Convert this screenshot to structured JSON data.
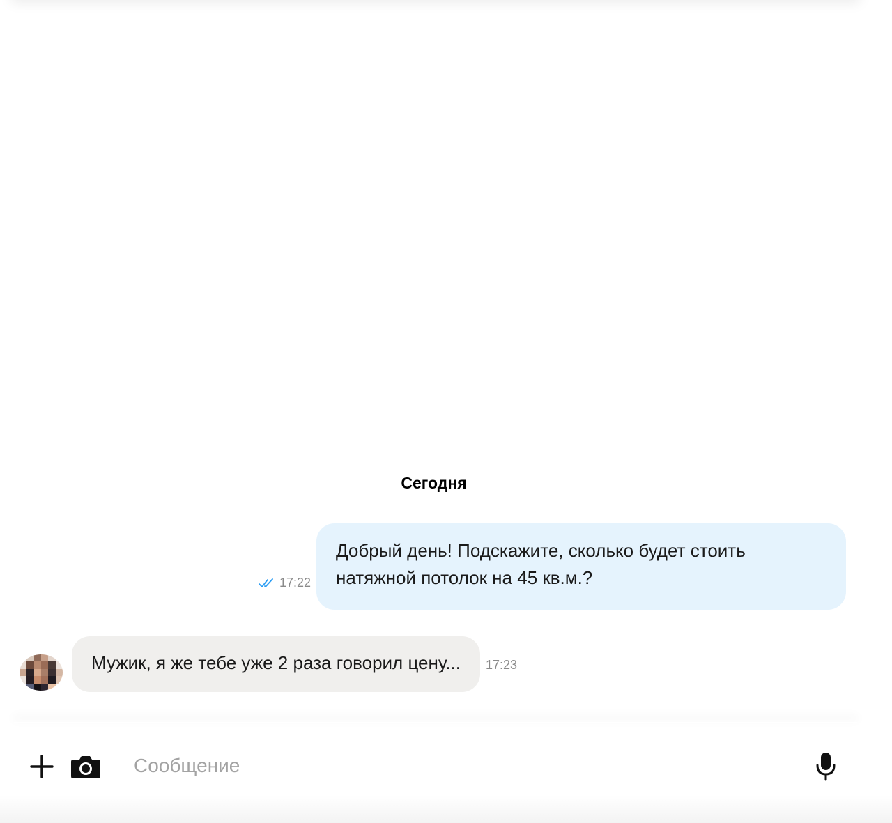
{
  "chat": {
    "day_separator": "Сегодня",
    "messages": [
      {
        "direction": "outgoing",
        "lines": [
          "Добрый день! Подскажите, сколько будет стоить",
          "натяжной потолок на 45 кв.м.?"
        ],
        "time": "17:22",
        "status": "read",
        "status_icon": "double-check-icon"
      },
      {
        "direction": "incoming",
        "text": "Мужик, я же тебе уже 2 раза говорил цену...",
        "time": "17:23",
        "avatar_icon": "pixelated-avatar"
      }
    ]
  },
  "composer": {
    "placeholder": "Сообщение",
    "value": "",
    "attach_icon": "plus-icon",
    "camera_icon": "camera-icon",
    "mic_icon": "microphone-icon"
  },
  "colors": {
    "outgoing_bubble": "#e5f3fd",
    "incoming_bubble": "#f0efed",
    "read_check": "#2a9df4",
    "timestamp": "#8a8a8a",
    "placeholder": "#a3a3a3"
  }
}
